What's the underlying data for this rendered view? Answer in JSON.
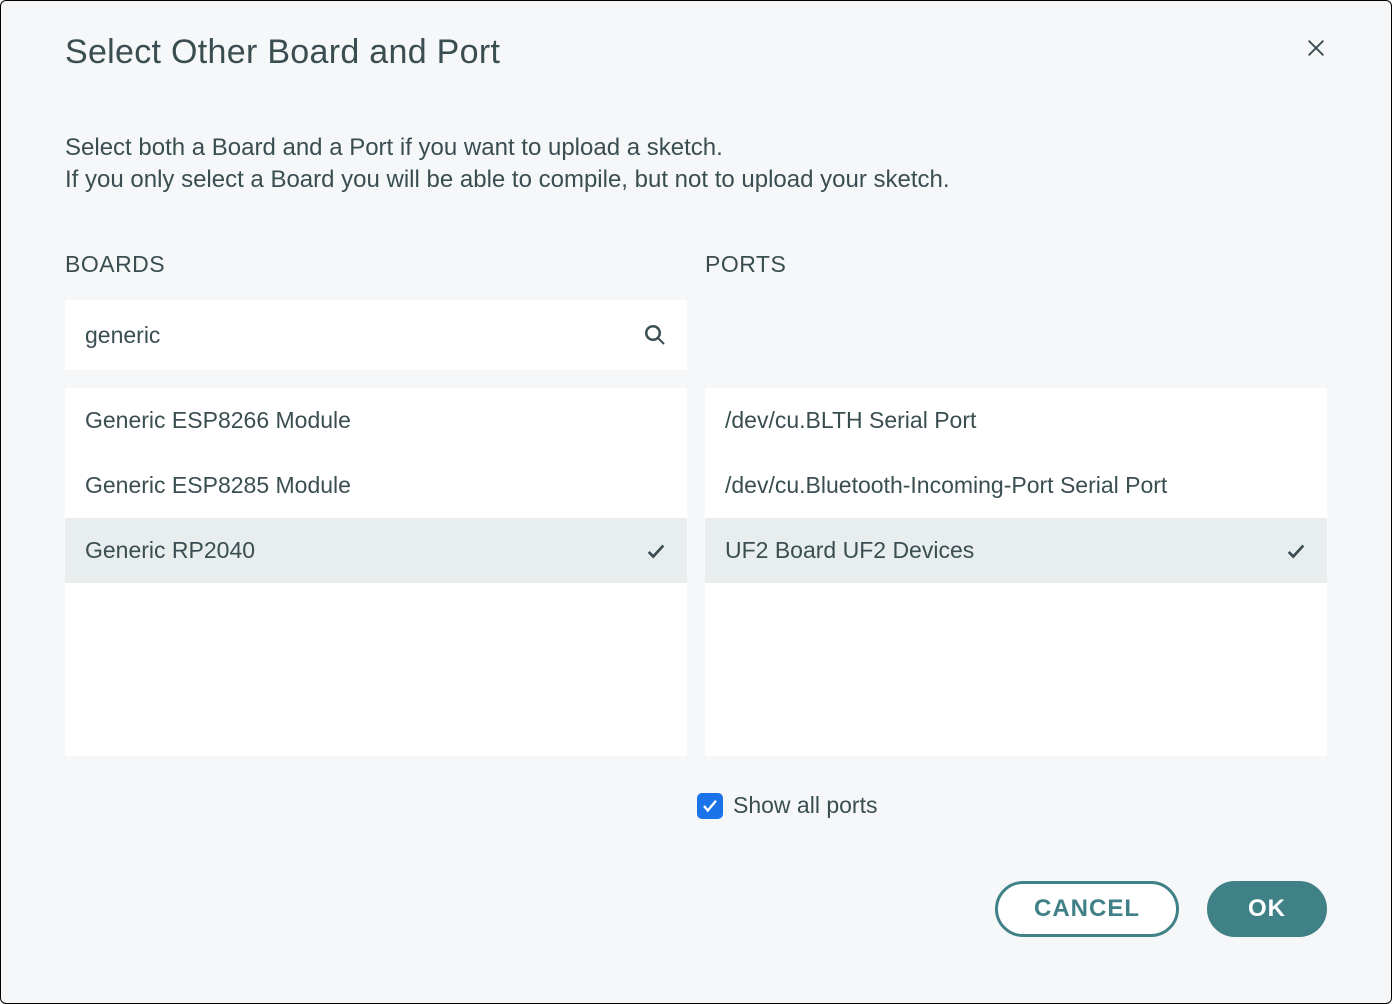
{
  "dialog": {
    "title": "Select Other Board and Port",
    "instruction_line1": "Select both a Board and a Port if you want to upload a sketch.",
    "instruction_line2": "If you only select a Board you will be able to compile, but not to upload your sketch."
  },
  "boards": {
    "header": "BOARDS",
    "search_value": "generic",
    "items": [
      {
        "label": "Generic ESP8266 Module",
        "selected": false
      },
      {
        "label": "Generic ESP8285 Module",
        "selected": false
      },
      {
        "label": "Generic RP2040",
        "selected": true
      }
    ]
  },
  "ports": {
    "header": "PORTS",
    "items": [
      {
        "label": "/dev/cu.BLTH Serial Port",
        "selected": false
      },
      {
        "label": "/dev/cu.Bluetooth-Incoming-Port Serial Port",
        "selected": false
      },
      {
        "label": "UF2 Board UF2 Devices",
        "selected": true
      }
    ],
    "show_all_label": "Show all ports",
    "show_all_checked": true
  },
  "buttons": {
    "cancel": "CANCEL",
    "ok": "OK"
  }
}
